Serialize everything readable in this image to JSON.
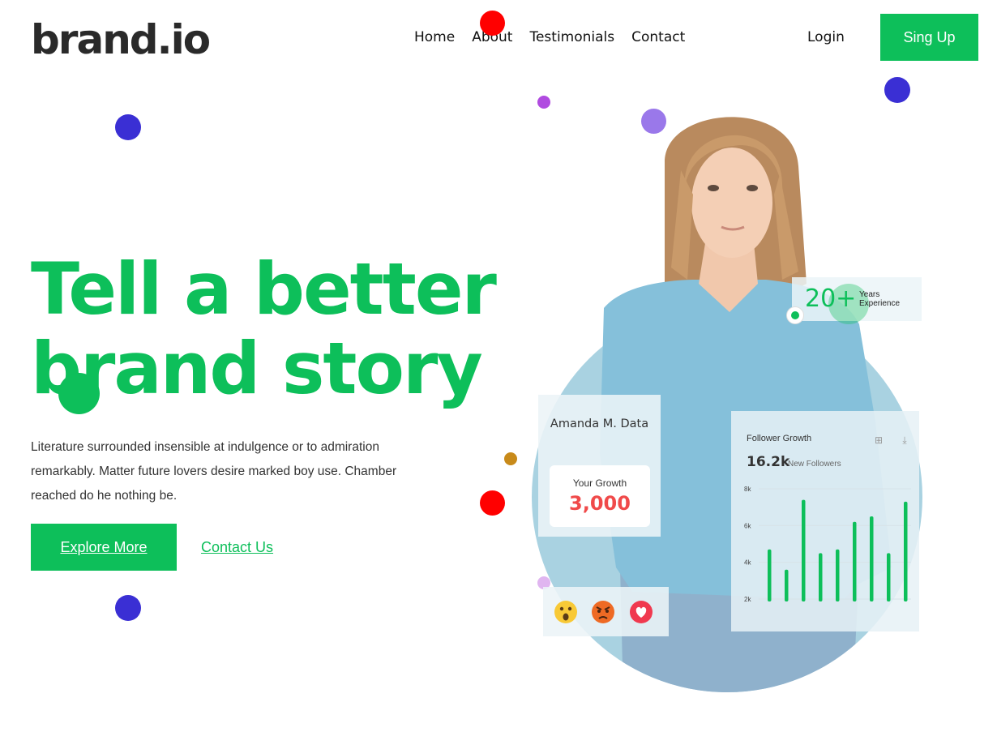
{
  "header": {
    "logo": "brand.io",
    "nav": [
      "Home",
      "About",
      "Testimonials",
      "Contact"
    ],
    "login": "Login",
    "signup": "Sing Up"
  },
  "hero": {
    "title_line1": "Tell a better",
    "title_line2": "brand story",
    "text": "Literature surrounded insensible at indulgence or to admiration remarkably. Matter future lovers desire marked boy use. Chamber reached do he nothing be.",
    "explore_label": "Explore More",
    "contact_label": "Contact Us"
  },
  "badge": {
    "value": "20+",
    "caption": "Years Experience"
  },
  "profile_card": {
    "name": "Amanda M. Data",
    "growth_label": "Your Growth",
    "growth_value": "3,000"
  },
  "follower_card": {
    "title": "Follower Growth",
    "count": "16.2k",
    "count_label": "New Followers",
    "icons": [
      "grid-icon",
      "download-icon"
    ]
  },
  "reactions": [
    "surprised-emoji-icon",
    "angry-emoji-icon",
    "heart-reaction-icon"
  ],
  "colors": {
    "accent": "#0dbf5a",
    "growth_value": "#f04a4a",
    "circle": "#a9d2e1"
  },
  "chart_data": {
    "type": "bar",
    "title": "Follower Growth",
    "yticks": [
      "8k",
      "6k",
      "4k",
      "2k"
    ],
    "ylim": [
      1000,
      8000
    ],
    "values": [
      4700,
      3600,
      7400,
      4500,
      4700,
      6200,
      6500,
      4500,
      7300
    ],
    "grid": true
  }
}
